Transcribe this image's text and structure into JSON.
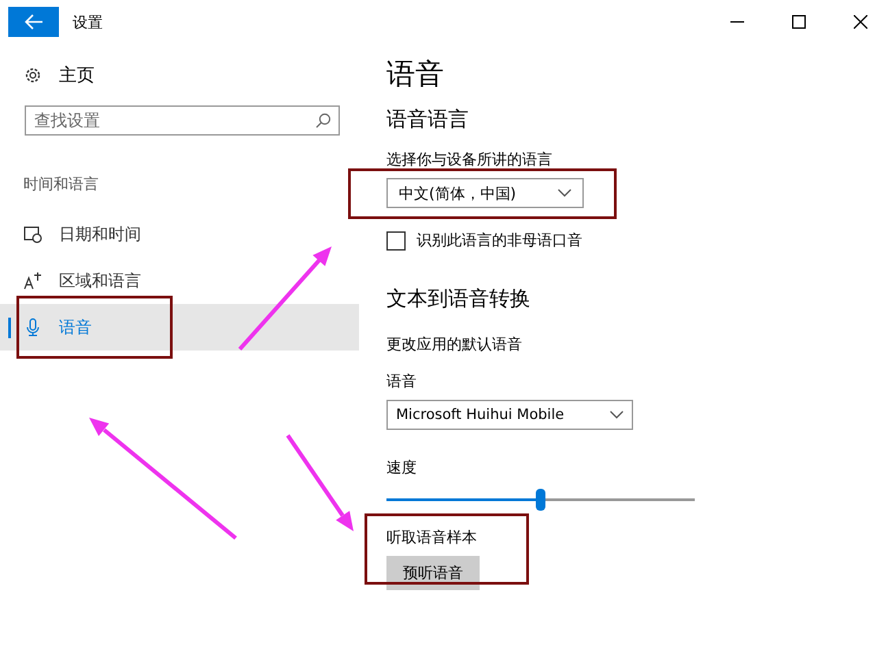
{
  "window": {
    "title": "设置"
  },
  "sidebar": {
    "home": "主页",
    "search": {
      "placeholder": "查找设置"
    },
    "section": "时间和语言",
    "items": [
      {
        "label": "日期和时间",
        "selected": false,
        "highlighted": false
      },
      {
        "label": "区域和语言",
        "selected": false,
        "highlighted": false
      },
      {
        "label": "语音",
        "selected": true,
        "highlighted": true
      }
    ]
  },
  "page": {
    "title": "语音",
    "speech_language": {
      "heading": "语音语言",
      "label": "选择你与设备所讲的语言",
      "dropdown": "中文(简体，中国)",
      "highlighted": true,
      "checkbox": {
        "label": "识别此语言的非母语口音",
        "checked": false
      }
    },
    "tts": {
      "heading": "文本到语音转换",
      "description": "更改应用的默认语音",
      "voice_label": "语音",
      "voice": "Microsoft Huihui Mobile",
      "speed_label": "速度",
      "speed": {
        "level": 0.5
      },
      "sample_label": "听取语音样本",
      "sample_button": "预听语音",
      "highlighted": true
    }
  }
}
